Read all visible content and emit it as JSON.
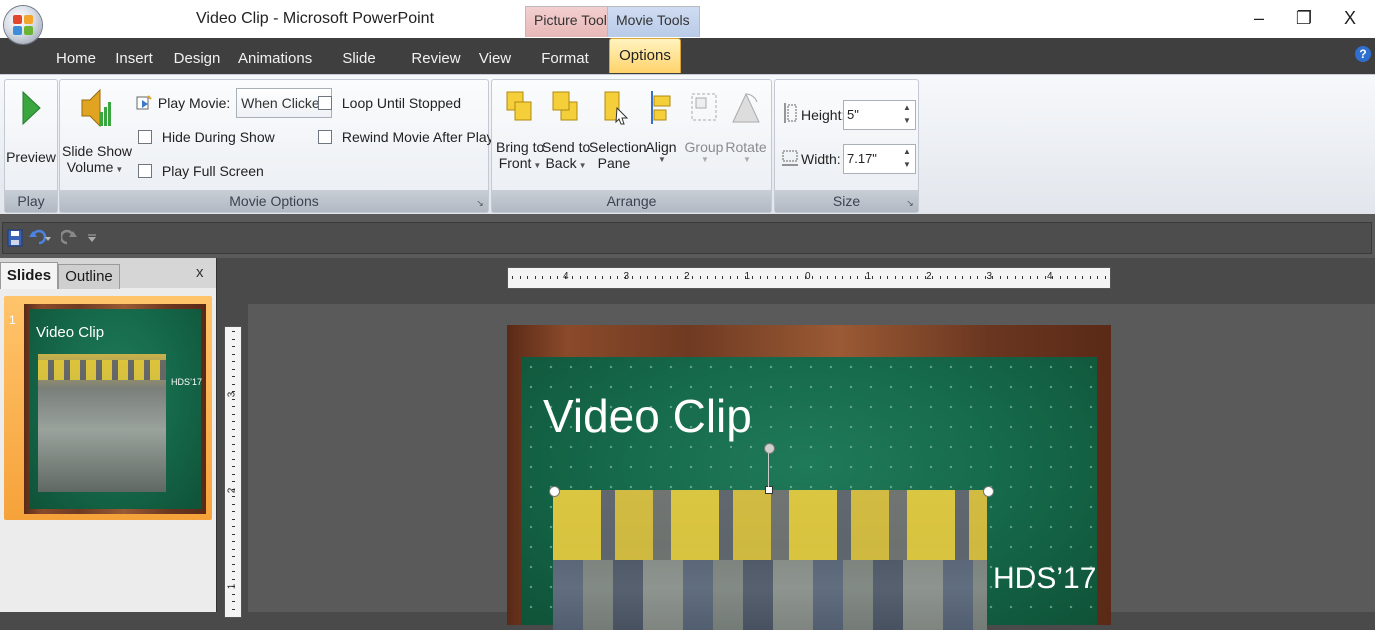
{
  "window": {
    "title": "Video Clip - Microsoft PowerPoint",
    "context_tabs": [
      "Picture Tools",
      "Movie Tools"
    ],
    "controls": {
      "minimize": "–",
      "restore": "❐",
      "close": "X"
    }
  },
  "ribbon_tabs": [
    "Home",
    "Insert",
    "Design",
    "Animations",
    "Slide Show",
    "Review",
    "View",
    "Format",
    "Options"
  ],
  "active_tab": "Options",
  "help_glyph": "?",
  "groups": {
    "play": {
      "title": "Play",
      "preview_label": "Preview"
    },
    "movie_options": {
      "title": "Movie Options",
      "volume_label_1": "Slide Show",
      "volume_label_2": "Volume",
      "play_movie_label": "Play Movie:",
      "play_movie_value": "When Clicked",
      "hide_during_show": "Hide During Show",
      "play_full_screen": "Play Full Screen",
      "loop_until_stopped": "Loop Until Stopped",
      "rewind_after_playing": "Rewind Movie After Playing"
    },
    "arrange": {
      "title": "Arrange",
      "bring_to_front_1": "Bring to",
      "bring_to_front_2": "Front",
      "send_to_back_1": "Send to",
      "send_to_back_2": "Back",
      "selection_pane_1": "Selection",
      "selection_pane_2": "Pane",
      "align": "Align",
      "group": "Group",
      "rotate": "Rotate"
    },
    "size": {
      "title": "Size",
      "height_label": "Height:",
      "height_value": "5\"",
      "width_label": "Width:",
      "width_value": "7.17\""
    }
  },
  "panel": {
    "tab_slides": "Slides",
    "tab_outline": "Outline",
    "close": "x",
    "slide_number": "1"
  },
  "slide": {
    "title": "Video Clip",
    "caption": "HDS’17"
  },
  "ruler": {
    "h_labels": [
      "4",
      "3",
      "2",
      "1",
      "0",
      "1",
      "2",
      "3",
      "4"
    ],
    "v_labels": [
      "3",
      "2",
      "1"
    ]
  },
  "colors": {
    "accent_tab": "#ffd36a",
    "board_green": "#166b4c",
    "frame_brown": "#7a3f24",
    "thumb_highlight": "#f6a23a"
  }
}
